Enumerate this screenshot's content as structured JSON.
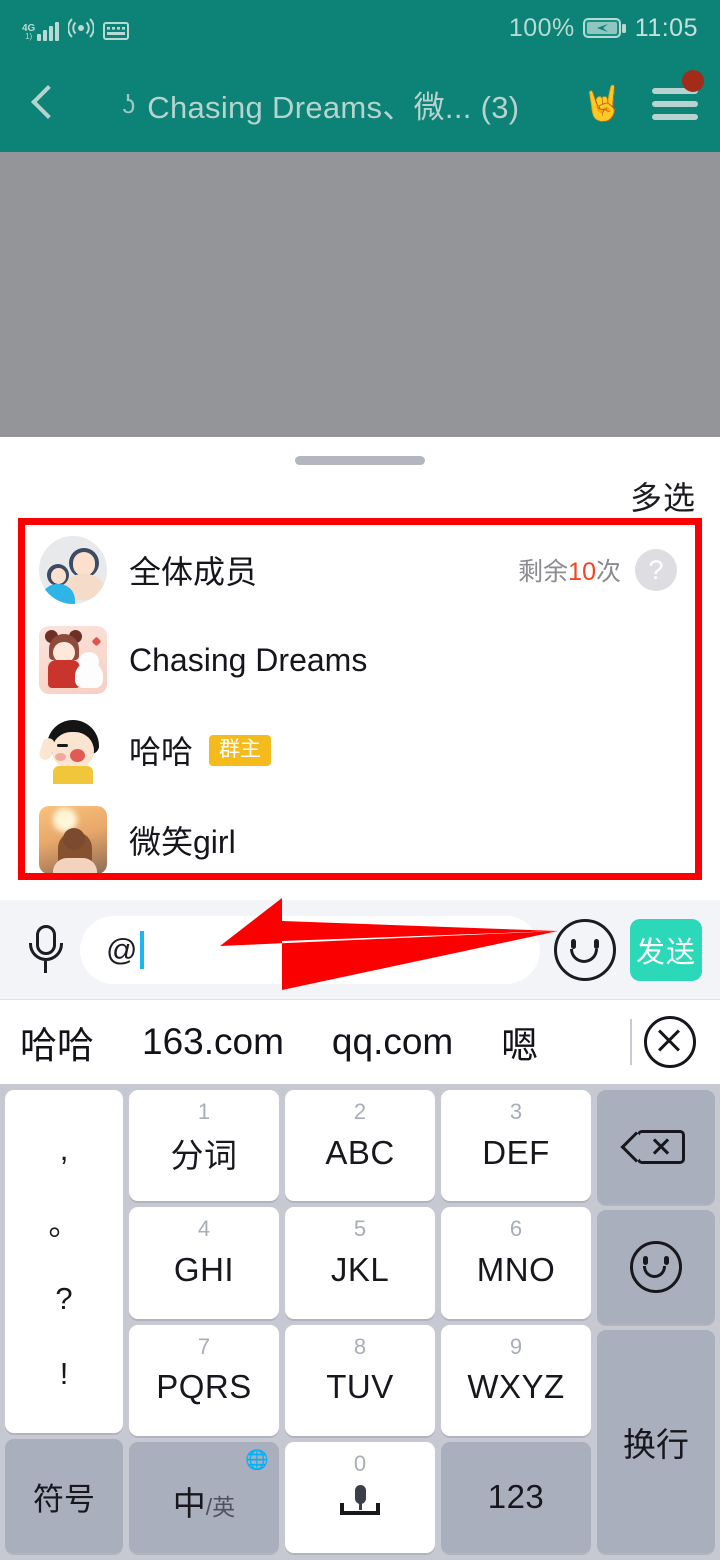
{
  "status_bar": {
    "network": "4G",
    "network_sub": "1)",
    "battery_percent": "100%",
    "time": "11:05",
    "icons": [
      "signal-bars-icon",
      "hotspot-icon",
      "keyboard-icon",
      "battery-charging-icon"
    ]
  },
  "app_bar": {
    "back": "back-chevron",
    "ear_icon": "ʖ",
    "title": "Chasing Dreams、微... (3)",
    "hand_icon": "hand-rock-icon",
    "menu_icon": "hamburger-menu-icon",
    "badge": true,
    "background_color": "#0d8276",
    "text_color": "#b6d3cf"
  },
  "sheet": {
    "multi_select_label": "多选",
    "highlight_color": "#fb0000",
    "members": [
      {
        "name": "全体成员",
        "avatar": "group-all-members-avatar",
        "remaining_prefix": "剩余",
        "remaining_count": "10",
        "remaining_suffix": "次",
        "help": "?",
        "tag": ""
      },
      {
        "name": "Chasing Dreams",
        "avatar": "girl-with-dog-avatar",
        "tag": ""
      },
      {
        "name": "哈哈",
        "avatar": "cartoon-face-avatar",
        "tag": "群主"
      },
      {
        "name": "微笑girl",
        "avatar": "sunset-photo-avatar",
        "tag": ""
      }
    ]
  },
  "input_bar": {
    "mic_icon": "microphone-icon",
    "text_value": "@",
    "emoji_icon": "smiley-face-icon",
    "send_label": "发送",
    "send_color": "#2bd9b8",
    "caret_color": "#19b6f0"
  },
  "annotation": {
    "arrow_color": "#fb0000",
    "arrow": "left-pointing-arrow"
  },
  "candidate_bar": {
    "candidates": [
      "哈哈",
      "163.com",
      "qq.com",
      "嗯"
    ],
    "close_icon": "close-circle-icon"
  },
  "keyboard": {
    "punctuation": [
      ",",
      "。",
      "?",
      "!"
    ],
    "symbol_key": "符号",
    "rows": [
      [
        {
          "num": "1",
          "label": "分词"
        },
        {
          "num": "2",
          "label": "ABC"
        },
        {
          "num": "3",
          "label": "DEF"
        }
      ],
      [
        {
          "num": "4",
          "label": "GHI"
        },
        {
          "num": "5",
          "label": "JKL"
        },
        {
          "num": "6",
          "label": "MNO"
        }
      ],
      [
        {
          "num": "7",
          "label": "PQRS"
        },
        {
          "num": "8",
          "label": "TUV"
        },
        {
          "num": "9",
          "label": "WXYZ"
        }
      ]
    ],
    "lang_key_main": "中",
    "lang_key_sub": "/英",
    "globe_icon": "globe-icon",
    "space_num": "0",
    "space_icon": "microphone-icon",
    "num_key": "123",
    "backspace_icon": "backspace-icon",
    "emoji_key_icon": "smiley-face-icon",
    "enter_label": "换行"
  }
}
